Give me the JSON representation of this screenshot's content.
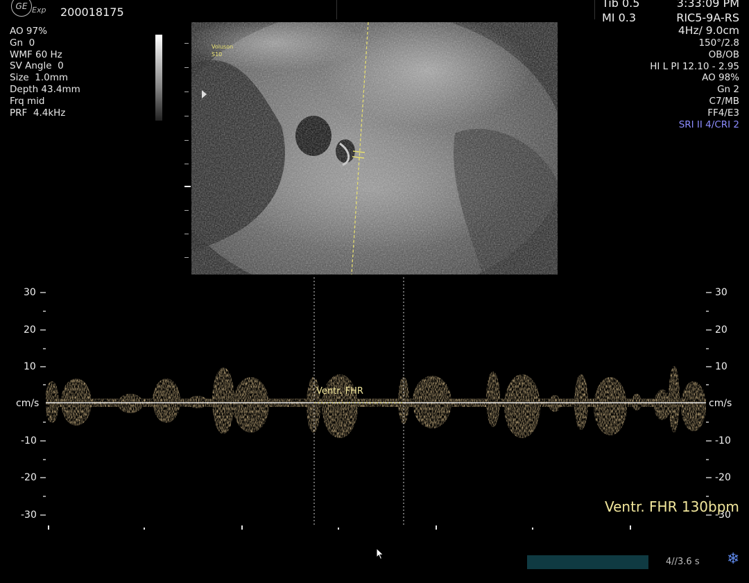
{
  "header": {
    "patient_id": "200018175",
    "logo_text": "GE",
    "logo_sub": "Exp",
    "tib": "Tib  0.5",
    "mi": "MI  0.3",
    "time": "3:33:09 PM",
    "probe": "RIC5-9A-RS"
  },
  "left_params": [
    "AO 97%",
    "Gn  0",
    "WMF 60 Hz",
    "SV Angle  0",
    "Size  1.0mm",
    "Depth 43.4mm",
    "Frq mid",
    "PRF  4.4kHz"
  ],
  "right_params": {
    "rate_depth": "4Hz/ 9.0cm",
    "lines": [
      "150°/2.8",
      "OB/OB",
      "HI L PI 12.10 - 2.95",
      "AO 98%",
      "Gn  2",
      "C7/MB",
      "FF4/E3"
    ],
    "sri": "SRI II 4/CRI 2"
  },
  "image": {
    "system_label_1": "Voluson",
    "system_label_2": "S10"
  },
  "doppler": {
    "unit": "cm/s",
    "ticks": [
      "30",
      "20",
      "10",
      "-10",
      "-20",
      "-30"
    ],
    "measurement_label": "Ventr. FHR",
    "result": "Ventr. FHR 130bpm"
  },
  "cine": {
    "text": "4//3.6 s"
  },
  "colors": {
    "spectral": "#f0b45a",
    "label_yellow": "#f2e79c",
    "sri_blue": "#8c8cff",
    "cine_bar": "#0f3a42"
  },
  "icons": {
    "freeze": "snowflake-icon",
    "cursor": "mouse-pointer-icon",
    "logo": "ge-logo-icon"
  }
}
